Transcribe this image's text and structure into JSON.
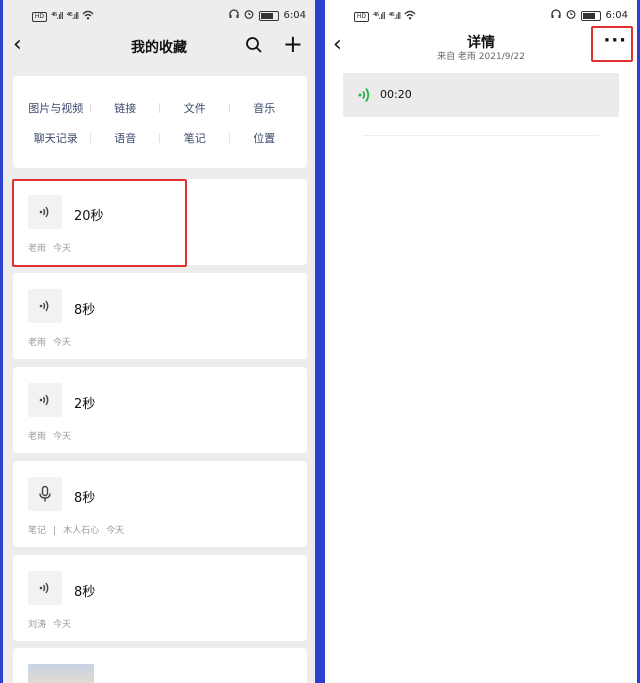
{
  "status": {
    "left": "HD B ⁴⁶.ıll ⁴⁶.ıll",
    "time": "6:04"
  },
  "left": {
    "title": "我的收藏",
    "categories": [
      "图片与视频",
      "链接",
      "文件",
      "音乐",
      "聊天记录",
      "语音",
      "笔记",
      "位置"
    ],
    "items": [
      {
        "title": "20秒",
        "meta": [
          "老雨",
          "今天"
        ],
        "icon": "voice-icon"
      },
      {
        "title": "8秒",
        "meta": [
          "老雨",
          "今天"
        ],
        "icon": "voice-icon"
      },
      {
        "title": "2秒",
        "meta": [
          "老雨",
          "今天"
        ],
        "icon": "voice-icon"
      },
      {
        "title": "8秒",
        "meta": [
          "笔记",
          "|",
          "木人石心",
          "今天"
        ],
        "icon": "microphone-icon"
      },
      {
        "title": "8秒",
        "meta": [
          "刘涛",
          "今天"
        ],
        "icon": "voice-icon"
      }
    ]
  },
  "right": {
    "title": "详情",
    "subtitle": "来自 老雨 2021/9/22",
    "voice": {
      "duration": "00:20",
      "color": "#27b24a"
    }
  },
  "colors": {
    "highlight": "#e03131",
    "frame": "#2b3fd1"
  }
}
